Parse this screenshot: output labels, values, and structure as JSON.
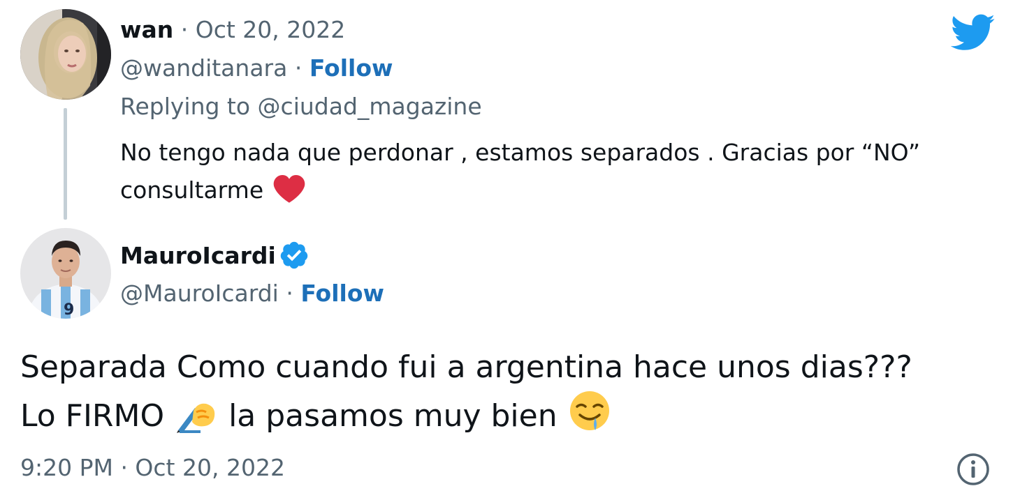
{
  "reply_tweet": {
    "display_name": "wan",
    "separator": " · ",
    "date": "Oct 20, 2022",
    "handle": "@wanditanara",
    "follow_separator": " · ",
    "follow_label": "Follow",
    "replying_prefix": "Replying to ",
    "replying_to": "@ciudad_magazine",
    "text": "No tengo nada que perdonar , estamos separados . Gracias por “NO” consultarme",
    "emoji": "heart"
  },
  "main_tweet": {
    "display_name": "MauroIcardi",
    "verified": true,
    "handle": "@MauroIcardi",
    "follow_separator": " · ",
    "follow_label": "Follow",
    "text_line1": "Separada Como cuando fui a argentina hace unos dias???",
    "text_line2_a": "Lo FIRMO ",
    "text_line2_b": " la pasamos muy bien ",
    "emojis": [
      "writing-hand",
      "drooling-face"
    ],
    "timestamp": "9:20 PM · Oct 20, 2022"
  },
  "colors": {
    "twitter_blue": "#1d9bf0",
    "follow_blue": "#1d6fb8",
    "secondary_text": "#536471",
    "heart_red": "#dd2e44"
  }
}
